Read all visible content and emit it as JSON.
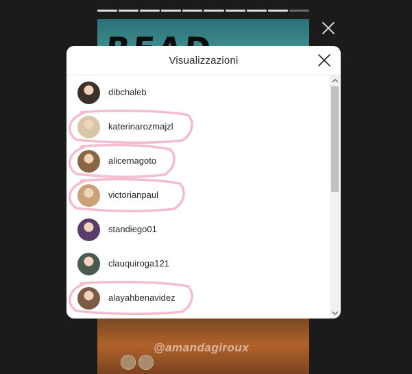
{
  "story": {
    "top_text": "READ ALL!",
    "handle": "@amandagiroux",
    "progress_segments": 10,
    "progress_done": 9
  },
  "modal": {
    "title": "Visualizzazioni"
  },
  "viewers": [
    {
      "username": "dibchaleb",
      "avatar_color": "#3b3128",
      "highlighted": false
    },
    {
      "username": "katerinarozmajzl",
      "avatar_color": "#d9c5a7",
      "highlighted": true
    },
    {
      "username": "alicemagoto",
      "avatar_color": "#8a6646",
      "highlighted": true
    },
    {
      "username": "victorianpaul",
      "avatar_color": "#c9a27a",
      "highlighted": true
    },
    {
      "username": "standiego01",
      "avatar_color": "#5a3c6b",
      "highlighted": false
    },
    {
      "username": "clauquiroga121",
      "avatar_color": "#4a5a4f",
      "highlighted": false
    },
    {
      "username": "alayahbenavidez",
      "avatar_color": "#7d5a45",
      "highlighted": true
    }
  ],
  "colors": {
    "highlight": "#f3b6c8",
    "text": "#262626",
    "modal_bg": "#ffffff",
    "page_bg": "#1b1b1b"
  },
  "icons": {
    "modal_close": "close-icon",
    "story_close": "close-icon"
  }
}
